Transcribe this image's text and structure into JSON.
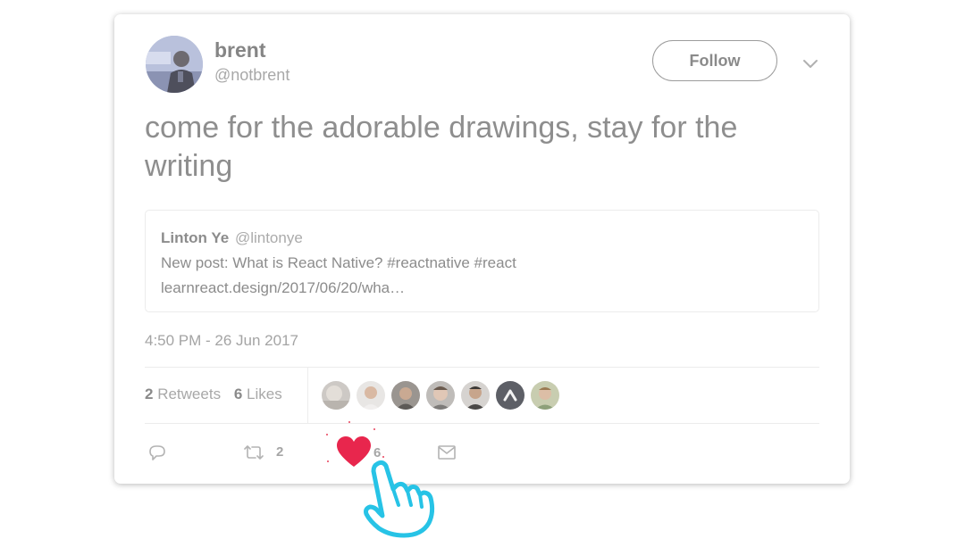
{
  "tweet": {
    "author": {
      "name": "brent",
      "handle": "@notbrent",
      "avatar_icon": "avatar-photo"
    },
    "follow_label": "Follow",
    "more_icon": "chevron-down-icon",
    "text": "come for the adorable drawings, stay for the writing",
    "quote": {
      "author_name": "Linton Ye",
      "author_handle": "@lintonye",
      "line1": "New post: What is React Native? #reactnative #react",
      "line2": "learnreact.design/2017/06/20/wha…"
    },
    "timestamp": "4:50 PM - 26 Jun 2017",
    "stats": {
      "retweets_count": "2",
      "retweets_label": "Retweets",
      "likes_count": "6",
      "likes_label": "Likes"
    },
    "likers": [
      "liker-1",
      "liker-2",
      "liker-3",
      "liker-4",
      "liker-5",
      "liker-6",
      "liker-7"
    ],
    "actions": {
      "reply_icon": "reply-icon",
      "retweet_icon": "retweet-icon",
      "retweet_count": "2",
      "like_icon": "heart-icon",
      "like_count": "6",
      "dm_icon": "mail-icon"
    }
  },
  "colors": {
    "heart": "#e8264d",
    "cursor_outline": "#27c3e6",
    "text_muted": "#8a8a8a"
  },
  "cursor_icon": "pointing-hand-cursor-icon"
}
